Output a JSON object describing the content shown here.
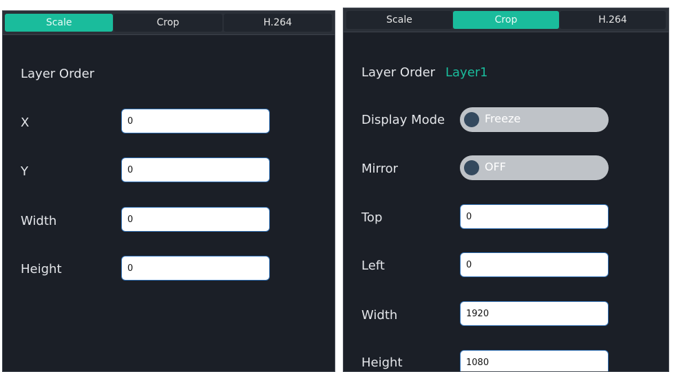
{
  "left_panel": {
    "tabs": [
      {
        "label": "Scale",
        "active": true
      },
      {
        "label": "Crop",
        "active": false
      },
      {
        "label": "H.264",
        "active": false
      }
    ],
    "layer_order_label": "Layer Order",
    "fields": [
      {
        "label": "X",
        "value": "0"
      },
      {
        "label": "Y",
        "value": "0"
      },
      {
        "label": "Width",
        "value": "0"
      },
      {
        "label": "Height",
        "value": "0"
      }
    ]
  },
  "right_panel": {
    "tabs": [
      {
        "label": "Scale",
        "active": false
      },
      {
        "label": "Crop",
        "active": true
      },
      {
        "label": "H.264",
        "active": false
      }
    ],
    "layer_order_label": "Layer Order",
    "layer_order_value": "Layer1",
    "display_mode": {
      "label": "Display Mode",
      "value": "Freeze"
    },
    "mirror": {
      "label": "Mirror",
      "value": "OFF"
    },
    "fields": [
      {
        "label": "Top",
        "value": "0"
      },
      {
        "label": "Left",
        "value": "0"
      },
      {
        "label": "Width",
        "value": "1920"
      },
      {
        "label": "Height",
        "value": "1080"
      }
    ]
  },
  "colors": {
    "accent": "#1abc9c",
    "panel_bg": "#1b1f27",
    "toggle_bg": "#bfc3c8",
    "knob": "#34495e"
  }
}
